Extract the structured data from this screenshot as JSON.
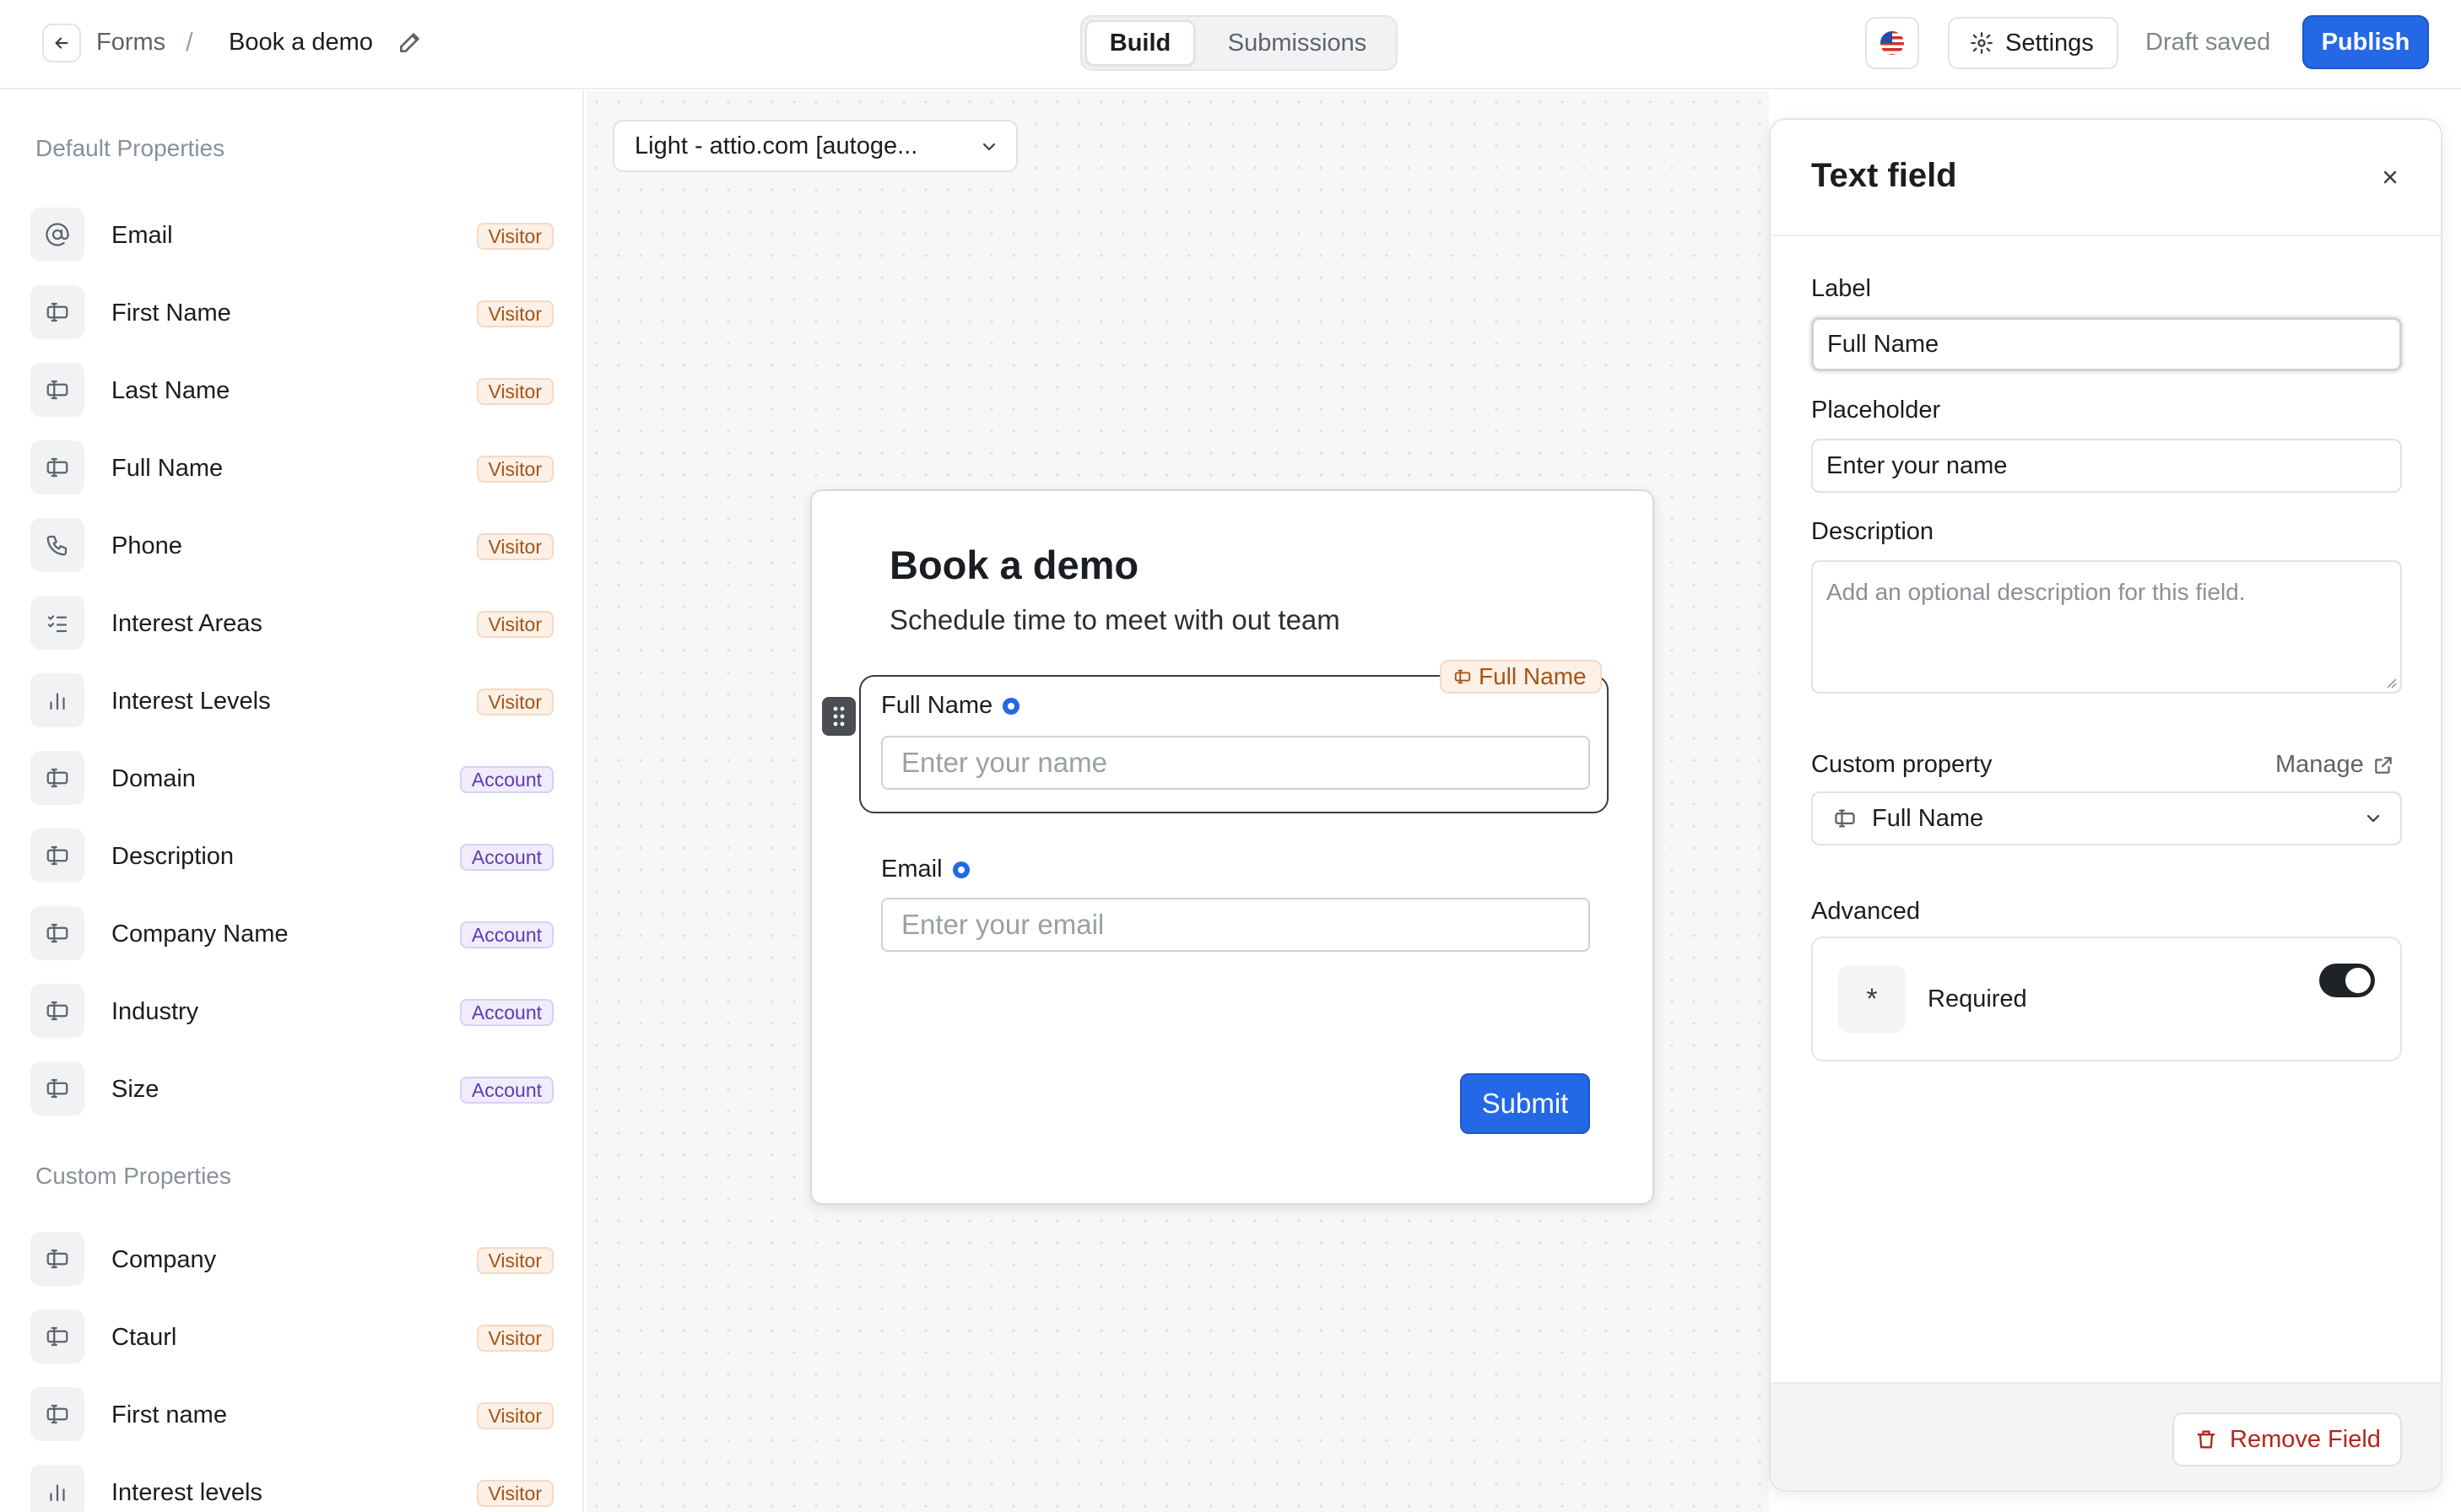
{
  "header": {
    "breadcrumb_root": "Forms",
    "breadcrumb_sep": "/",
    "breadcrumb_current": "Book a demo",
    "tabs": [
      {
        "label": "Build",
        "active": true
      },
      {
        "label": "Submissions",
        "active": false
      }
    ],
    "settings_label": "Settings",
    "status": "Draft saved",
    "publish_label": "Publish"
  },
  "sidebar": {
    "default_title": "Default Properties",
    "default_items": [
      {
        "label": "Email",
        "badge": "Visitor",
        "icon": "at-sign-icon"
      },
      {
        "label": "First Name",
        "badge": "Visitor",
        "icon": "text-field-icon"
      },
      {
        "label": "Last Name",
        "badge": "Visitor",
        "icon": "text-field-icon"
      },
      {
        "label": "Full Name",
        "badge": "Visitor",
        "icon": "text-field-icon"
      },
      {
        "label": "Phone",
        "badge": "Visitor",
        "icon": "phone-icon"
      },
      {
        "label": "Interest Areas",
        "badge": "Visitor",
        "icon": "checklist-icon"
      },
      {
        "label": "Interest Levels",
        "badge": "Visitor",
        "icon": "bar-chart-icon"
      },
      {
        "label": "Domain",
        "badge": "Account",
        "icon": "text-field-icon"
      },
      {
        "label": "Description",
        "badge": "Account",
        "icon": "text-field-icon"
      },
      {
        "label": "Company Name",
        "badge": "Account",
        "icon": "text-field-icon"
      },
      {
        "label": "Industry",
        "badge": "Account",
        "icon": "text-field-icon"
      },
      {
        "label": "Size",
        "badge": "Account",
        "icon": "text-field-icon"
      }
    ],
    "custom_title": "Custom Properties",
    "custom_items": [
      {
        "label": "Company",
        "badge": "Visitor",
        "icon": "text-field-icon"
      },
      {
        "label": "Ctaurl",
        "badge": "Visitor",
        "icon": "text-field-icon"
      },
      {
        "label": "First name",
        "badge": "Visitor",
        "icon": "text-field-icon"
      },
      {
        "label": "Interest levels",
        "badge": "Visitor",
        "icon": "bar-chart-icon"
      }
    ]
  },
  "canvas": {
    "theme_select": "Light - attio.com [autoge...",
    "form": {
      "title": "Book a demo",
      "subtitle": "Schedule time to meet with out team",
      "selected_tag": "Full Name",
      "fields": [
        {
          "label": "Full Name",
          "placeholder": "Enter your name"
        },
        {
          "label": "Email",
          "placeholder": "Enter your email"
        }
      ],
      "submit_label": "Submit"
    }
  },
  "panel": {
    "title": "Text field",
    "label_heading": "Label",
    "label_value": "Full Name",
    "placeholder_heading": "Placeholder",
    "placeholder_value": "Enter your name",
    "description_heading": "Description",
    "description_placeholder": "Add an optional description for this field.",
    "custom_property_heading": "Custom property",
    "manage_label": "Manage",
    "custom_property_value": "Full Name",
    "advanced_heading": "Advanced",
    "required_label": "Required",
    "required_symbol": "*",
    "required_on": true,
    "remove_label": "Remove Field"
  },
  "colors": {
    "accent": "#2468e6",
    "visitor_badge": "#a35418",
    "account_badge": "#5b3bb5",
    "danger": "#b3261e"
  }
}
